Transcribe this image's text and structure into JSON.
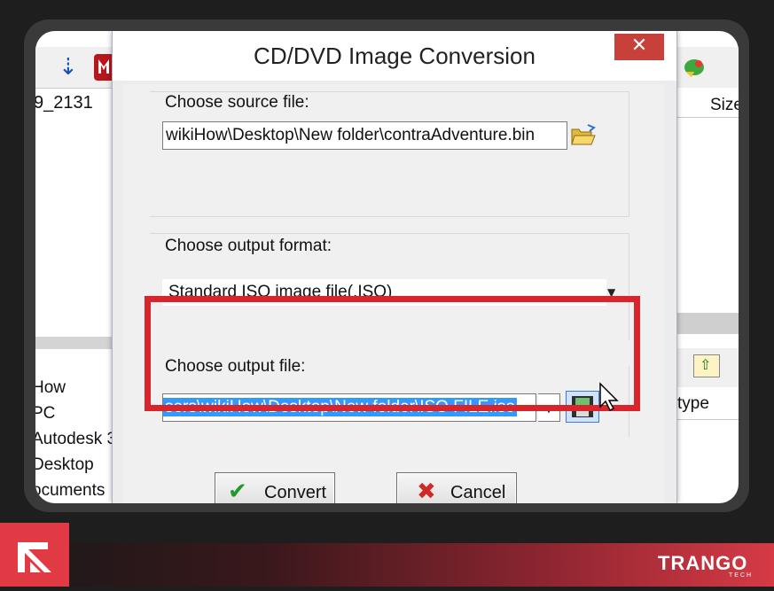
{
  "dialog": {
    "title": "CD/DVD Image Conversion",
    "close_symbol": "✕",
    "source": {
      "label": "Choose source file:",
      "value": "wikiHow\\Desktop\\New folder\\contraAdventure.bin",
      "browse_icon": "folder-open-icon"
    },
    "format": {
      "label": "Choose output format:",
      "selected": "Standard ISO image file(.ISO)"
    },
    "output": {
      "label": "Choose output file:",
      "value": "sers\\wikiHow\\Desktop\\New folder\\ISO FILE.iso",
      "save_icon": "save-icon"
    },
    "buttons": {
      "convert": "Convert",
      "cancel": "Cancel"
    }
  },
  "background": {
    "left_filename": "9_2131",
    "tree_items": [
      "How",
      "PC",
      "Autodesk 3",
      "Desktop",
      "ocuments"
    ],
    "size_header": "Size",
    "type_header": "type"
  },
  "brand": {
    "name": "TRANGO",
    "sub": "TECH"
  },
  "colors": {
    "highlight": "#d8252c",
    "close_button": "#c7403a",
    "selection": "#3399ff"
  }
}
